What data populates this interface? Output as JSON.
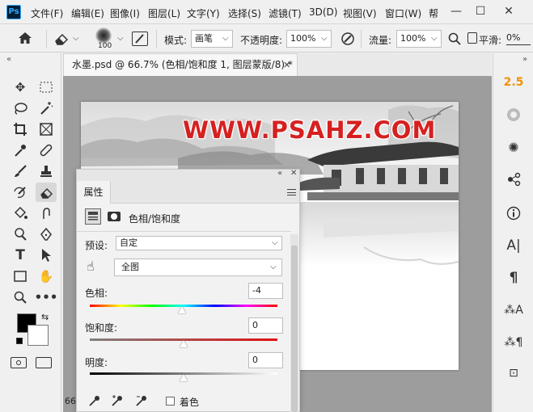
{
  "app": {
    "logo": "Ps"
  },
  "menu": [
    "文件(F)",
    "编辑(E)",
    "图像(I)",
    "图层(L)",
    "文字(Y)",
    "选择(S)",
    "滤镜(T)",
    "3D(D)",
    "视图(V)",
    "窗口(W)",
    "帮"
  ],
  "window_controls": {
    "minimize": "—",
    "maximize": "☐",
    "close": "✕"
  },
  "options_bar": {
    "brush_size": "100",
    "mode_label": "模式:",
    "mode_value": "画笔",
    "opacity_label": "不透明度:",
    "opacity_value": "100%",
    "flow_label": "流量:",
    "flow_value": "100%",
    "smoothing_label": "平滑:",
    "smoothing_value": "0%"
  },
  "document": {
    "tab_title": "水墨.psd @ 66.7% (色相/饱和度 1, 图层蒙版/8) *",
    "tab_close": "✕",
    "watermark_text": "WWW.PSAHZ.COM",
    "zoom_readout": "66"
  },
  "properties_panel": {
    "tab_label": "属性",
    "adjustment_title": "色相/饱和度",
    "preset_label": "预设:",
    "preset_value": "自定",
    "channel_value": "全图",
    "hue_label": "色相:",
    "hue_value": "-4",
    "saturation_label": "饱和度:",
    "saturation_value": "0",
    "lightness_label": "明度:",
    "lightness_value": "0",
    "colorize_label": "着色",
    "colorize_checked": false,
    "hue_slider_fraction": 0.49,
    "saturation_slider_fraction": 0.5,
    "lightness_slider_fraction": 0.5
  },
  "right_dock": {
    "badge_text": "2.5",
    "badge_color": "#f29100"
  },
  "colors": {
    "foreground": "#000000",
    "background": "#ffffff",
    "canvas_bg": "#9d9d9d",
    "watermark": "#d62020"
  }
}
